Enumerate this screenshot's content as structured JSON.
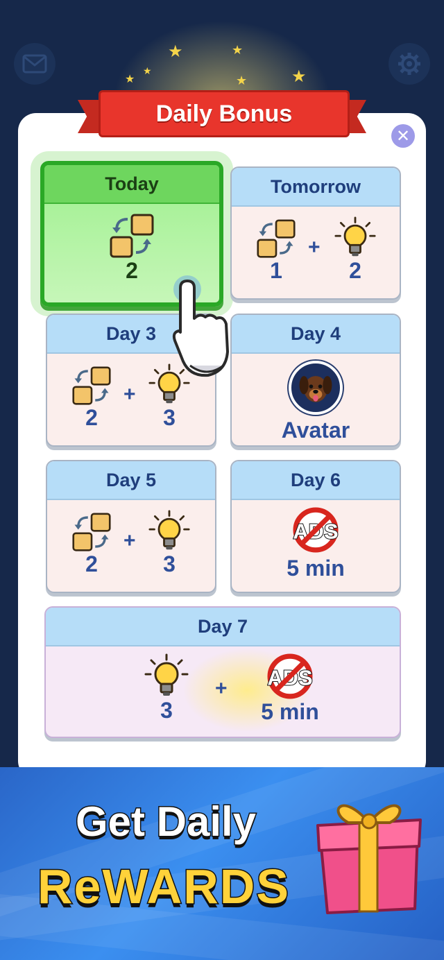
{
  "header": {
    "mail_icon": "mail-icon",
    "settings_icon": "gear-icon"
  },
  "dialog": {
    "title": "Daily Bonus",
    "close_icon": "close-icon",
    "days": [
      {
        "label": "Today",
        "rewards": [
          {
            "icon": "swap-tiles-icon",
            "amount": "2"
          }
        ]
      },
      {
        "label": "Tomorrow",
        "rewards": [
          {
            "icon": "swap-tiles-icon",
            "amount": "1"
          },
          {
            "icon": "lightbulb-icon",
            "amount": "2"
          }
        ]
      },
      {
        "label": "Day 3",
        "rewards": [
          {
            "icon": "swap-tiles-icon",
            "amount": "2"
          },
          {
            "icon": "lightbulb-icon",
            "amount": "3"
          }
        ]
      },
      {
        "label": "Day 4",
        "rewards": [
          {
            "icon": "dog-avatar-icon",
            "amount": "Avatar"
          }
        ]
      },
      {
        "label": "Day 5",
        "rewards": [
          {
            "icon": "swap-tiles-icon",
            "amount": "2"
          },
          {
            "icon": "lightbulb-icon",
            "amount": "3"
          }
        ]
      },
      {
        "label": "Day 6",
        "rewards": [
          {
            "icon": "no-ads-icon",
            "amount": "5 min"
          }
        ]
      },
      {
        "label": "Day 7",
        "rewards": [
          {
            "icon": "lightbulb-icon",
            "amount": "3"
          },
          {
            "icon": "no-ads-icon",
            "amount": "5 min"
          }
        ]
      }
    ],
    "plus": "+"
  },
  "promo": {
    "line1": "Get Daily",
    "line2": "ReWARDS",
    "gift_icon": "gift-box-icon"
  },
  "colors": {
    "background": "#16284a",
    "today_green": "#2aa826",
    "header_blue": "#b6ddf8",
    "number_blue": "#2f4f9a",
    "title_red": "#e8352c",
    "headline_yellow": "#ffd23a"
  }
}
